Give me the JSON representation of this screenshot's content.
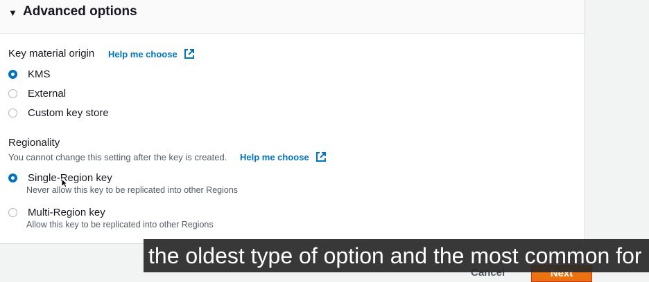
{
  "advanced": {
    "title": "Advanced options"
  },
  "key_material": {
    "label": "Key material origin",
    "help": "Help me choose",
    "options": [
      {
        "label": "KMS",
        "selected": true
      },
      {
        "label": "External",
        "selected": false
      },
      {
        "label": "Custom key store",
        "selected": false
      }
    ]
  },
  "regionality": {
    "label": "Regionality",
    "description": "You cannot change this setting after the key is created.",
    "help": "Help me choose",
    "options": [
      {
        "label": "Single-Region key",
        "description": "Never allow this key to be replicated into other Regions",
        "selected": true
      },
      {
        "label": "Multi-Region key",
        "description": "Allow this key to be replicated into other Regions",
        "selected": false
      }
    ]
  },
  "footer": {
    "cancel": "Cancel",
    "next": "Next"
  },
  "caption": "the oldest type of option and the most common for l",
  "colors": {
    "accent": "#0073bb",
    "primary_button": "#ec7211"
  }
}
